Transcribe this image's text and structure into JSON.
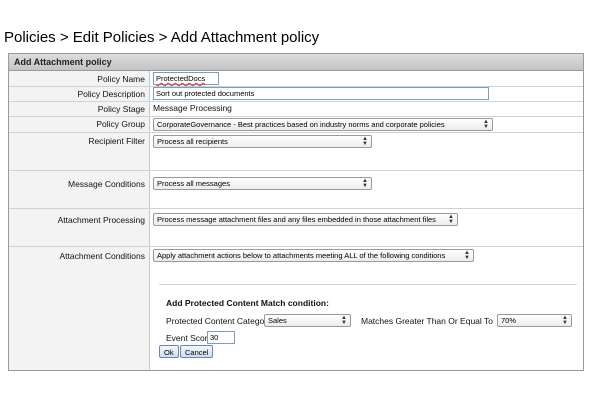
{
  "breadcrumb": "Policies > Edit Policies > Add Attachment policy",
  "panel": {
    "title": "Add Attachment policy"
  },
  "fields": {
    "policy_name": {
      "label": "Policy Name",
      "value": "ProtectedDocs"
    },
    "policy_description": {
      "label": "Policy Description",
      "value": "Sort out protected documents"
    },
    "policy_stage": {
      "label": "Policy Stage",
      "value": "Message Processing"
    },
    "policy_group": {
      "label": "Policy Group",
      "value": "CorporateGovernance - Best practices based on industry norms and corporate policies"
    },
    "recipient_filter": {
      "label": "Recipient Filter",
      "value": "Process all recipients"
    },
    "message_conditions": {
      "label": "Message Conditions",
      "value": "Process all messages"
    },
    "attachment_processing": {
      "label": "Attachment Processing",
      "value": "Process message attachment files and any files embedded in those attachment files"
    },
    "attachment_conditions": {
      "label": "Attachment Conditions",
      "value": "Apply attachment actions below to attachments meeting ALL of the following conditions"
    }
  },
  "match_condition": {
    "title": "Add Protected Content Match condition:",
    "category_label": "Protected Content Category",
    "category_value": "Sales",
    "matches_label": "Matches Greater Than Or Equal To",
    "matches_value": "70%",
    "event_score_label": "Event Score:",
    "event_score_value": "30",
    "ok_label": "Ok",
    "cancel_label": "Cancel"
  },
  "icons": {
    "select_arrow": "chevron-updown-icon"
  }
}
